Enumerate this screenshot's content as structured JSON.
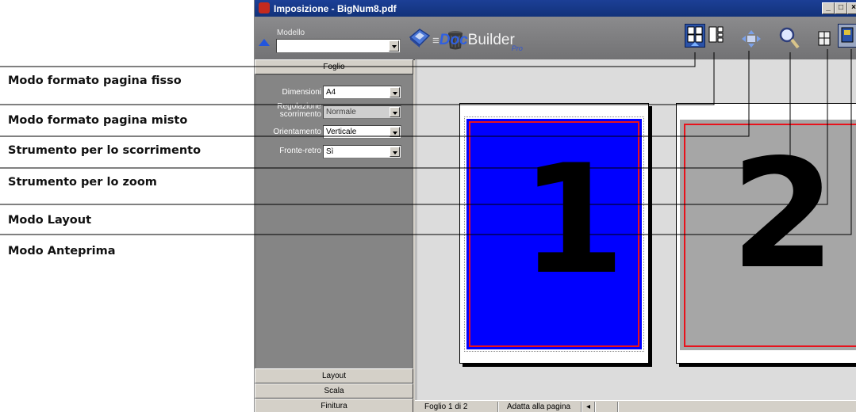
{
  "window": {
    "title": "Imposizione - BigNum8.pdf",
    "buttons": [
      "_",
      "□",
      "×"
    ]
  },
  "toolbar": {
    "modello_label": "Modello",
    "modello_value": "",
    "brand_doc": "Doc",
    "brand_builder": "Builder",
    "brand_pro": "Pro"
  },
  "sidebar": {
    "top_tab": "Foglio",
    "fields": [
      {
        "label": "Dimensioni",
        "value": "A4",
        "enabled": true
      },
      {
        "label": "Regolazione scorrimento",
        "value": "Normale",
        "enabled": false
      },
      {
        "label": "Orientamento",
        "value": "Verticale",
        "enabled": true
      },
      {
        "label": "Fronte-retro",
        "value": "Sì",
        "enabled": true
      }
    ],
    "bottom_tabs": [
      "Layout",
      "Scala",
      "Finitura"
    ]
  },
  "pages": [
    {
      "number": "1",
      "fill": "#0000ff"
    },
    {
      "number": "2",
      "fill": "#a6a6a6"
    }
  ],
  "status": {
    "sheet": "Foglio 1 di 2",
    "fit": "Adatta alla pagina",
    "nav": "◂"
  },
  "callouts": [
    "Modo formato pagina fisso",
    "Modo formato pagina misto",
    "Strumento per lo scorrimento",
    "Strumento per lo zoom",
    "Modo Layout",
    "Modo Anteprima"
  ],
  "colors": {
    "title_bar": "#12327a",
    "toolbar": "#7e7e80",
    "panel": "#858585",
    "active_mode": "#2a52a8",
    "safe_line": "#e8121c"
  }
}
